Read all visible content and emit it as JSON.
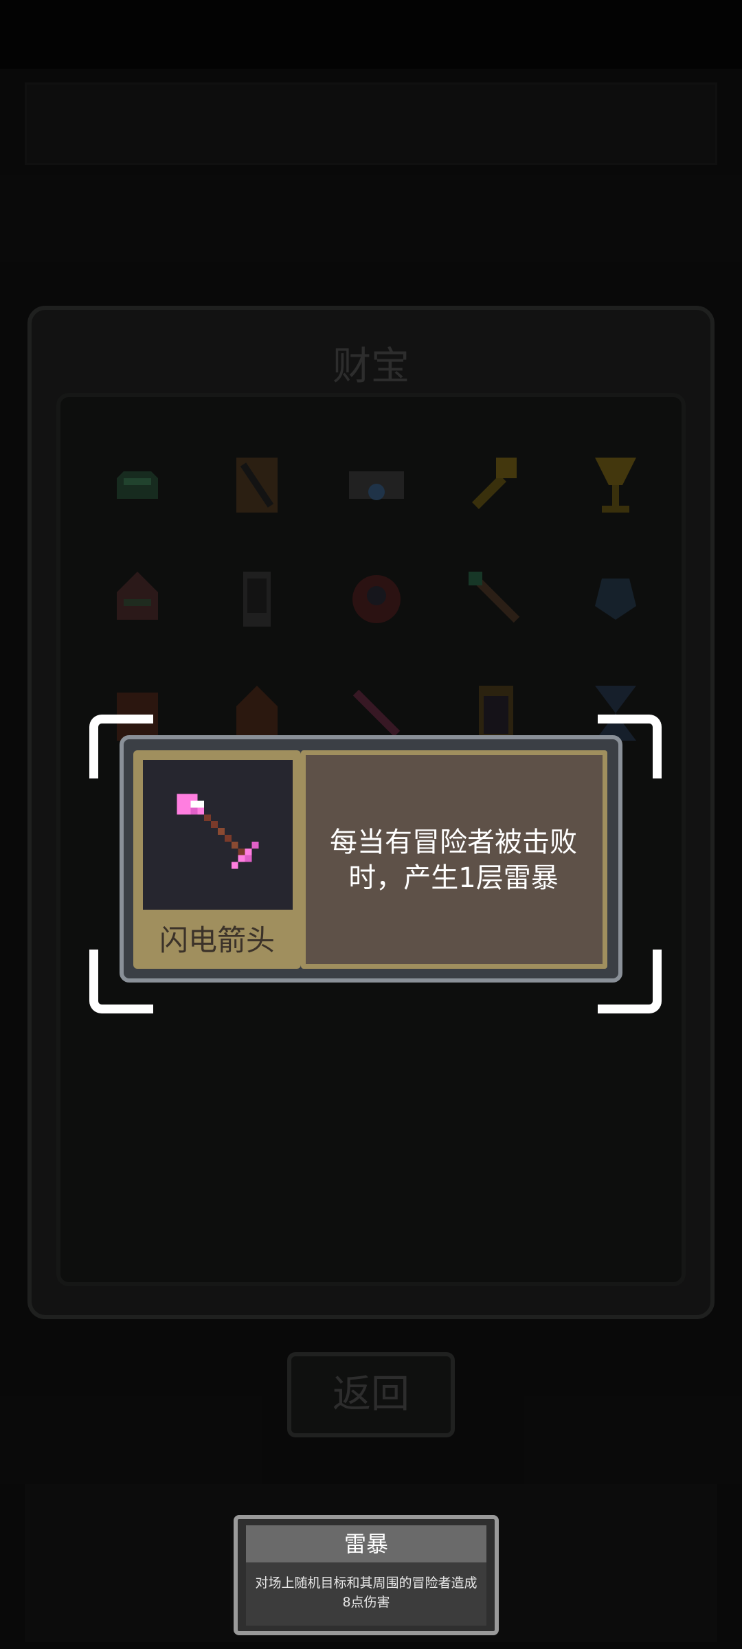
{
  "panel": {
    "title": "财宝"
  },
  "treasure_grid": {
    "icons": [
      "green-helmet-icon",
      "scroll-icon",
      "pouch-icon",
      "golden-key-icon",
      "golden-chalice-icon",
      "bandit-hat-icon",
      "phone-icon",
      "demon-orb-icon",
      "green-arrow-icon",
      "ghost-hand-icon",
      "barrel-icon",
      "hooded-mask-icon",
      "red-arrow-icon",
      "jar-icon",
      "hourglass-icon"
    ]
  },
  "item_card": {
    "name": "闪电箭头",
    "description": "每当有冒险者被击败时，产生1层雷暴",
    "icon": "lightning-arrow-icon"
  },
  "back_button": {
    "label": "返回"
  },
  "tooltip": {
    "title": "雷暴",
    "description": "对场上随机目标和其周围的冒险者造成8点伤害"
  },
  "colors": {
    "card_gold": "#a08f5e",
    "card_brown": "#5e5148",
    "background": "#0d0d0d"
  }
}
